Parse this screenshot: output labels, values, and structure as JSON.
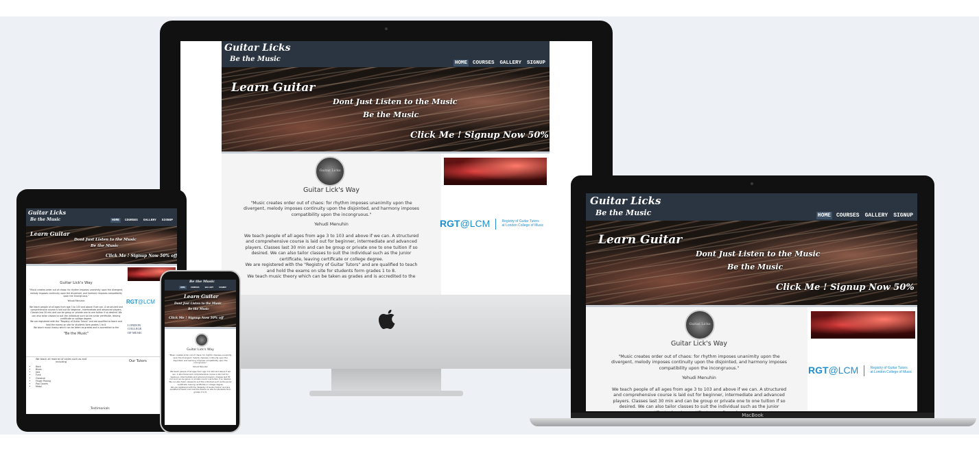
{
  "site": {
    "logo_line1": "Guitar Licks",
    "logo_line2": "Be the Music",
    "nav": [
      "HOME",
      "COURSES",
      "GALLERY",
      "SIGNUP"
    ],
    "hero": {
      "title": "Learn Guitar",
      "tagline1": "Dont Just Listen to the Music",
      "tagline2": "Be the Music",
      "cta": "Click Me ! Signup Now 50% off"
    },
    "avatar_text": "Guitar Licks",
    "heading": "Guitar Lick's Way",
    "quote": "\"Music creates order out of chaos: for rhythm imposes unanimity upon the divergent, melody imposes continuity upon the disjointed, and harmony imposes compatibility upon the incongruous.\"",
    "quote_author": "Yehudi Menuhin",
    "para1": "We teach people of all ages from age 3 to 103 and above if we can. A structured and comprehensive course is laid out for beginner, intermediate and advanced players. Classes last 30 min and can be group or private one to one tuition if so desired. We can also tailor classes to suit the individual such as the junior certificate, leaving certificate or college degree.",
    "para2": "We are registered with the \"Registry of Guitar Tutors\" and are qualified to teach and hold the exams on site for students form grades 1 to 8.",
    "para3": "We teach music theory which can be taken as grades and is accredited to the",
    "motto": "\"Be the Music\"",
    "rgt": {
      "a": "RGT",
      "b": "@LCM",
      "c1": "Registry of Guitar Tutors",
      "c2": "at London College of Music"
    },
    "lcm": {
      "l1": "LONDON",
      "l2": "COLLEGE",
      "l3": "OF MUSIC"
    },
    "lessons_intro": "We teach all manner of styles such as and including",
    "styles": [
      "Rock",
      "Blues",
      "Jazz",
      "Funk",
      "Classical",
      "Finger Picking",
      "Pop Covers",
      "Metal"
    ],
    "tutors_heading": "Our Tutors",
    "testimonials": "Testimonials"
  },
  "device": {
    "laptop_label": "MacBook"
  },
  "colors": {
    "navbar": "#2b3541",
    "accent": "#1f8ecf",
    "page_bg": "#edf1f5"
  }
}
